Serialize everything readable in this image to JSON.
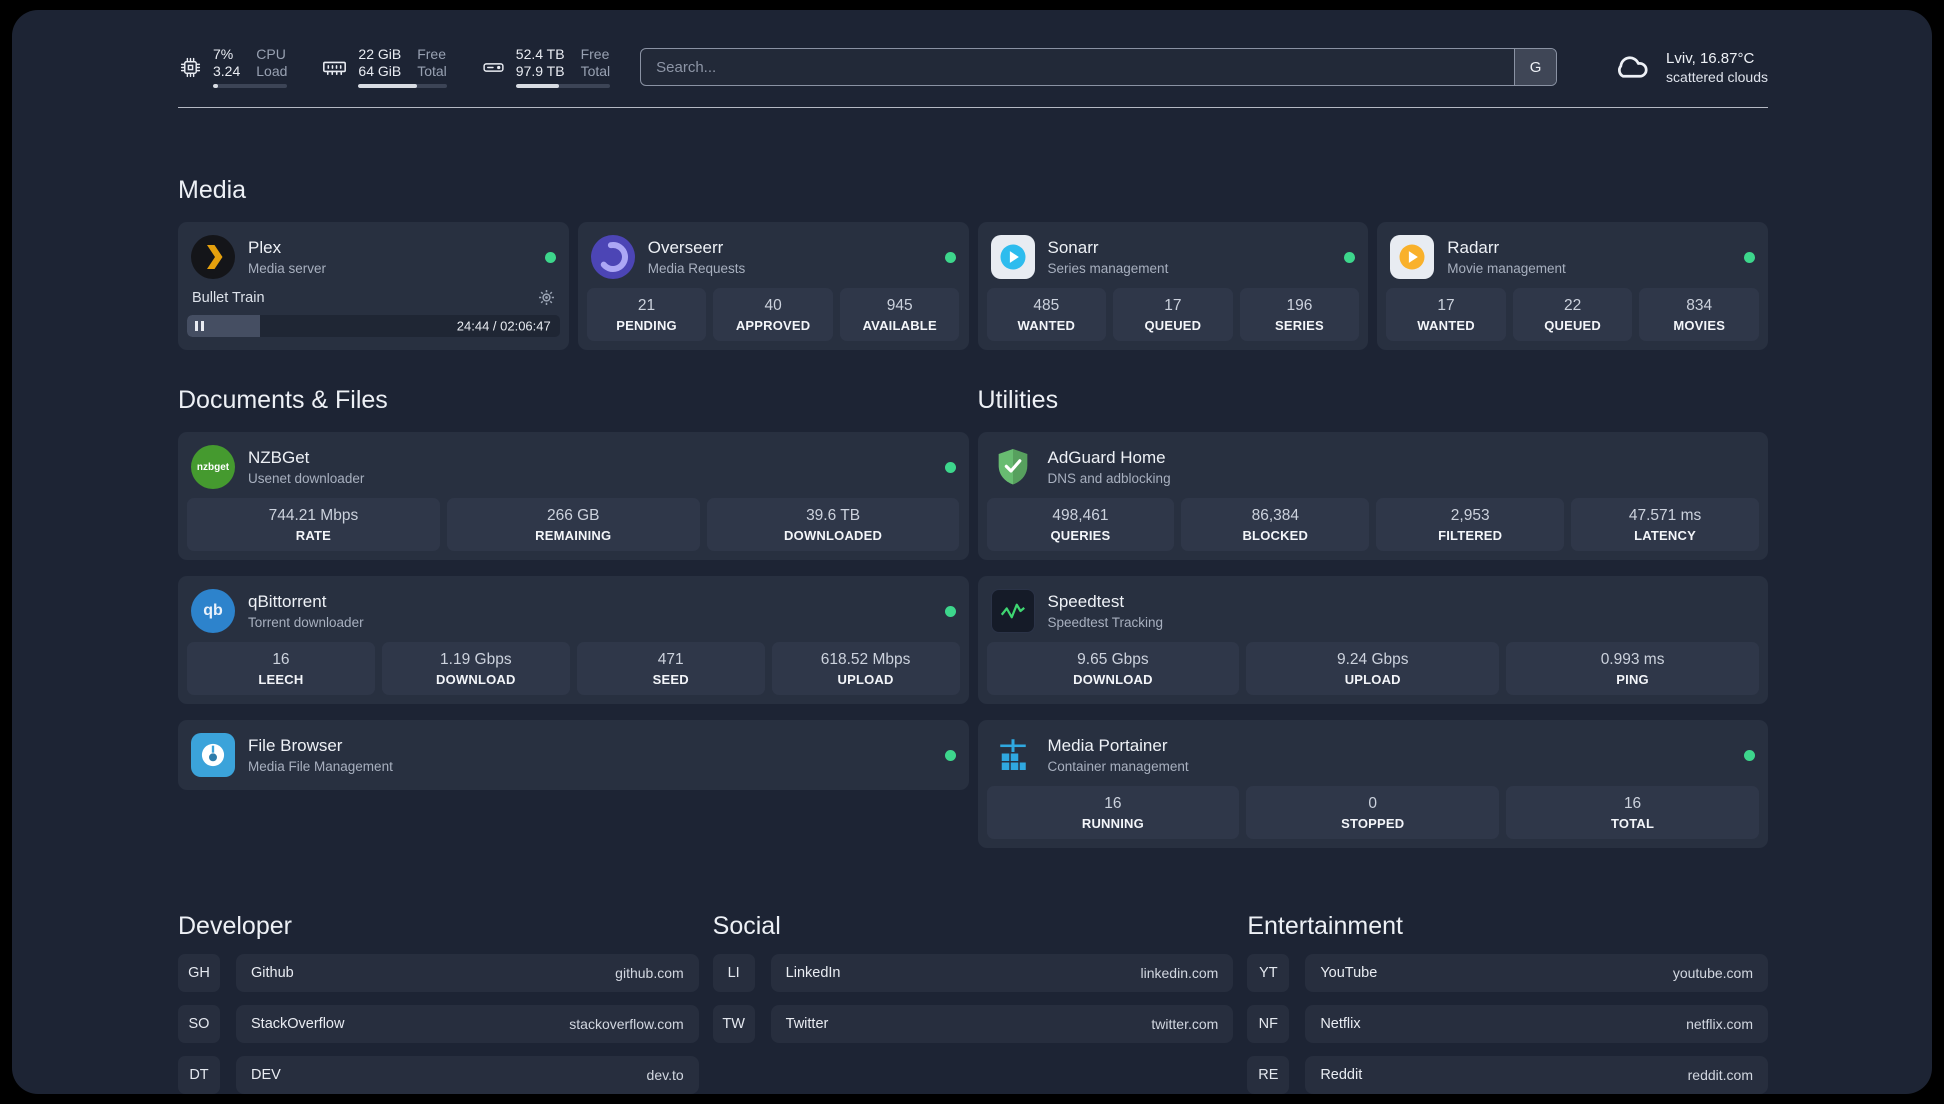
{
  "colors": {
    "background": "#1d2434",
    "card": "#283040",
    "stat_tile": "#2f3749",
    "status_online": "#3dd68c",
    "plex": "#e5a00d",
    "overseerr": "#4c45b5",
    "sonarr": "#2dbcee",
    "radarr": "#f9b12b",
    "nzbget": "#459a2f",
    "qbittorrent": "#2d83cc",
    "filebrowser": "#3ba3da",
    "adguard": "#68bc71",
    "speedtest": "#3fd672",
    "portainer": "#2fa8e0"
  },
  "header": {
    "cpu": {
      "value1": "7%",
      "value2": "3.24",
      "label1": "CPU",
      "label2": "Load",
      "bar_percent": 7
    },
    "ram": {
      "value1": "22 GiB",
      "value2": "64 GiB",
      "label1": "Free",
      "label2": "Total",
      "bar_percent": 66
    },
    "disk": {
      "value1": "52.4 TB",
      "value2": "97.9 TB",
      "label1": "Free",
      "label2": "Total",
      "bar_percent": 46
    },
    "search": {
      "placeholder": "Search...",
      "engine_button": "G"
    },
    "weather": {
      "location": "Lviv, 16.87°C",
      "condition": "scattered clouds"
    }
  },
  "media": {
    "heading": "Media",
    "plex": {
      "title": "Plex",
      "subtitle": "Media server",
      "now_playing": "Bullet Train",
      "time": "24:44 / 02:06:47",
      "progress_percent": 19.5
    },
    "overseerr": {
      "title": "Overseerr",
      "subtitle": "Media Requests",
      "stats": [
        {
          "value": "21",
          "label": "PENDING"
        },
        {
          "value": "40",
          "label": "APPROVED"
        },
        {
          "value": "945",
          "label": "AVAILABLE"
        }
      ]
    },
    "sonarr": {
      "title": "Sonarr",
      "subtitle": "Series management",
      "stats": [
        {
          "value": "485",
          "label": "WANTED"
        },
        {
          "value": "17",
          "label": "QUEUED"
        },
        {
          "value": "196",
          "label": "SERIES"
        }
      ]
    },
    "radarr": {
      "title": "Radarr",
      "subtitle": "Movie management",
      "stats": [
        {
          "value": "17",
          "label": "WANTED"
        },
        {
          "value": "22",
          "label": "QUEUED"
        },
        {
          "value": "834",
          "label": "MOVIES"
        }
      ]
    }
  },
  "documents": {
    "heading": "Documents & Files",
    "nzbget": {
      "title": "NZBGet",
      "subtitle": "Usenet downloader",
      "stats": [
        {
          "value": "744.21 Mbps",
          "label": "RATE"
        },
        {
          "value": "266 GB",
          "label": "REMAINING"
        },
        {
          "value": "39.6 TB",
          "label": "DOWNLOADED"
        }
      ]
    },
    "qbittorrent": {
      "title": "qBittorrent",
      "subtitle": "Torrent downloader",
      "stats": [
        {
          "value": "16",
          "label": "LEECH"
        },
        {
          "value": "1.19 Gbps",
          "label": "DOWNLOAD"
        },
        {
          "value": "471",
          "label": "SEED"
        },
        {
          "value": "618.52 Mbps",
          "label": "UPLOAD"
        }
      ]
    },
    "filebrowser": {
      "title": "File Browser",
      "subtitle": "Media File Management"
    }
  },
  "utilities": {
    "heading": "Utilities",
    "adguard": {
      "title": "AdGuard Home",
      "subtitle": "DNS and adblocking",
      "stats": [
        {
          "value": "498,461",
          "label": "QUERIES"
        },
        {
          "value": "86,384",
          "label": "BLOCKED"
        },
        {
          "value": "2,953",
          "label": "FILTERED"
        },
        {
          "value": "47.571 ms",
          "label": "LATENCY"
        }
      ]
    },
    "speedtest": {
      "title": "Speedtest",
      "subtitle": "Speedtest Tracking",
      "stats": [
        {
          "value": "9.65 Gbps",
          "label": "DOWNLOAD"
        },
        {
          "value": "9.24 Gbps",
          "label": "UPLOAD"
        },
        {
          "value": "0.993 ms",
          "label": "PING"
        }
      ]
    },
    "portainer": {
      "title": "Media Portainer",
      "subtitle": "Container management",
      "stats": [
        {
          "value": "16",
          "label": "RUNNING"
        },
        {
          "value": "0",
          "label": "STOPPED"
        },
        {
          "value": "16",
          "label": "TOTAL"
        }
      ]
    }
  },
  "bookmarks": {
    "developer": {
      "heading": "Developer",
      "items": [
        {
          "abbr": "GH",
          "name": "Github",
          "url": "github.com"
        },
        {
          "abbr": "SO",
          "name": "StackOverflow",
          "url": "stackoverflow.com"
        },
        {
          "abbr": "DT",
          "name": "DEV",
          "url": "dev.to"
        }
      ]
    },
    "social": {
      "heading": "Social",
      "items": [
        {
          "abbr": "LI",
          "name": "LinkedIn",
          "url": "linkedin.com"
        },
        {
          "abbr": "TW",
          "name": "Twitter",
          "url": "twitter.com"
        }
      ]
    },
    "entertainment": {
      "heading": "Entertainment",
      "items": [
        {
          "abbr": "YT",
          "name": "YouTube",
          "url": "youtube.com"
        },
        {
          "abbr": "NF",
          "name": "Netflix",
          "url": "netflix.com"
        },
        {
          "abbr": "RE",
          "name": "Reddit",
          "url": "reddit.com"
        }
      ]
    }
  }
}
